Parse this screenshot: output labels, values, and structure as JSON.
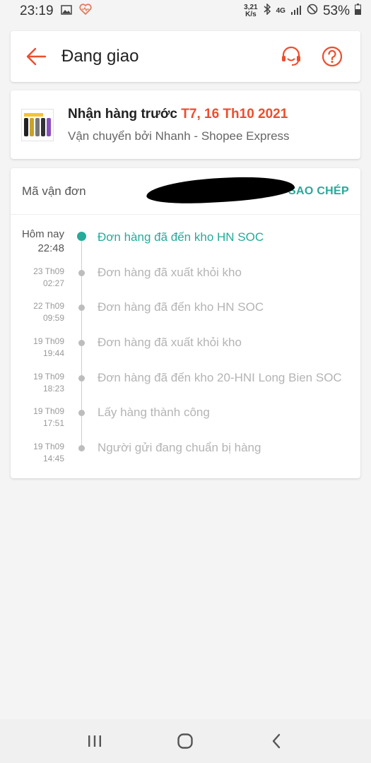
{
  "status_bar": {
    "time": "23:19",
    "speed_top": "3,21",
    "speed_bottom": "K/s",
    "network": "4G",
    "battery": "53%"
  },
  "header": {
    "title": "Đang giao",
    "back_icon": "arrow-left-icon",
    "support_icon": "headset-icon",
    "help_icon": "question-circle-icon"
  },
  "delivery": {
    "prefix": "Nhận hàng trước ",
    "date": "T7, 16 Th10 2021",
    "carrier": "Vận chuyển bởi Nhanh - Shopee Express"
  },
  "tracking": {
    "label": "Mã vận đơn",
    "copy_label": "SAO CHÉP",
    "events": [
      {
        "date": "Hôm nay",
        "time": "22:48",
        "desc": "Đơn hàng đã đến kho HN SOC"
      },
      {
        "date": "23 Th09",
        "time": "02:27",
        "desc": "Đơn hàng đã xuất khỏi kho"
      },
      {
        "date": "22 Th09",
        "time": "09:59",
        "desc": "Đơn hàng đã đến kho HN SOC"
      },
      {
        "date": "19 Th09",
        "time": "19:44",
        "desc": "Đơn hàng đã xuất khỏi kho"
      },
      {
        "date": "19 Th09",
        "time": "18:23",
        "desc": "Đơn hàng đã đến kho 20-HNI Long Bien SOC"
      },
      {
        "date": "19 Th09",
        "time": "17:51",
        "desc": "Lấy hàng thành công"
      },
      {
        "date": "19 Th09",
        "time": "14:45",
        "desc": "Người gửi đang chuẩn bị hàng"
      }
    ]
  },
  "colors": {
    "accent": "#ee4d2d",
    "teal": "#26aa99"
  }
}
